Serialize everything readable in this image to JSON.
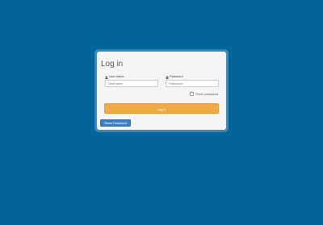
{
  "login": {
    "title": "Log in",
    "username": {
      "label": "User name",
      "icon": "user-icon",
      "placeholder": "Username",
      "value": ""
    },
    "password": {
      "label": "Password",
      "icon": "lock-icon",
      "placeholder": "Password",
      "value": ""
    },
    "show_password_label": "Show password",
    "show_password_checked": false,
    "login_button": "Log in",
    "reset_button": "Reset Password"
  },
  "colors": {
    "background": "#03659a",
    "panel_border": "#3c86b3",
    "panel": "#f5f5f5",
    "login_button": "#efaa47",
    "reset_button": "#3f80c4"
  }
}
